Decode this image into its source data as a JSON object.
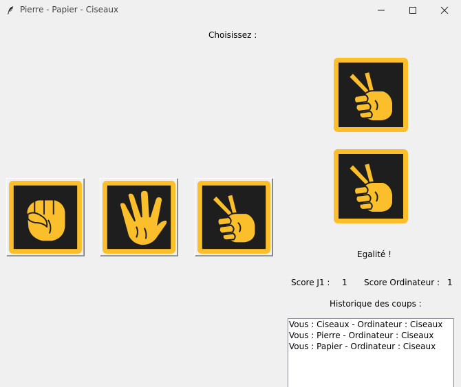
{
  "window": {
    "title": "Pierre - Papier - Ciseaux",
    "icon": "feather-icon",
    "controls": [
      "minimize-icon",
      "maximize-icon",
      "close-icon"
    ]
  },
  "prompt": "Choisissez :",
  "choices": [
    {
      "name": "Pierre",
      "icon": "rock-fist-icon"
    },
    {
      "name": "Papier",
      "icon": "paper-hand-icon"
    },
    {
      "name": "Ciseaux",
      "icon": "scissors-hand-icon"
    }
  ],
  "player_choice_icon": "scissors-hand-icon",
  "computer_choice_icon": "scissors-hand-icon",
  "result": "Egalité !",
  "score": {
    "player_label": "Score J1 :",
    "player_value": "1",
    "computer_label": "Score Ordinateur :",
    "computer_value": "1"
  },
  "history": {
    "title": "Historique des coups :",
    "lines": [
      "Vous : Ciseaux - Ordinateur : Ciseaux",
      "Vous : Pierre - Ordinateur : Ciseaux",
      "Vous : Papier - Ordinateur : Ciseaux"
    ]
  },
  "colors": {
    "tile_border": "#fbbf2c",
    "tile_inner": "#1e1e1e",
    "icon_fill": "#fbbf2c",
    "window_bg": "#f0f0f0"
  }
}
